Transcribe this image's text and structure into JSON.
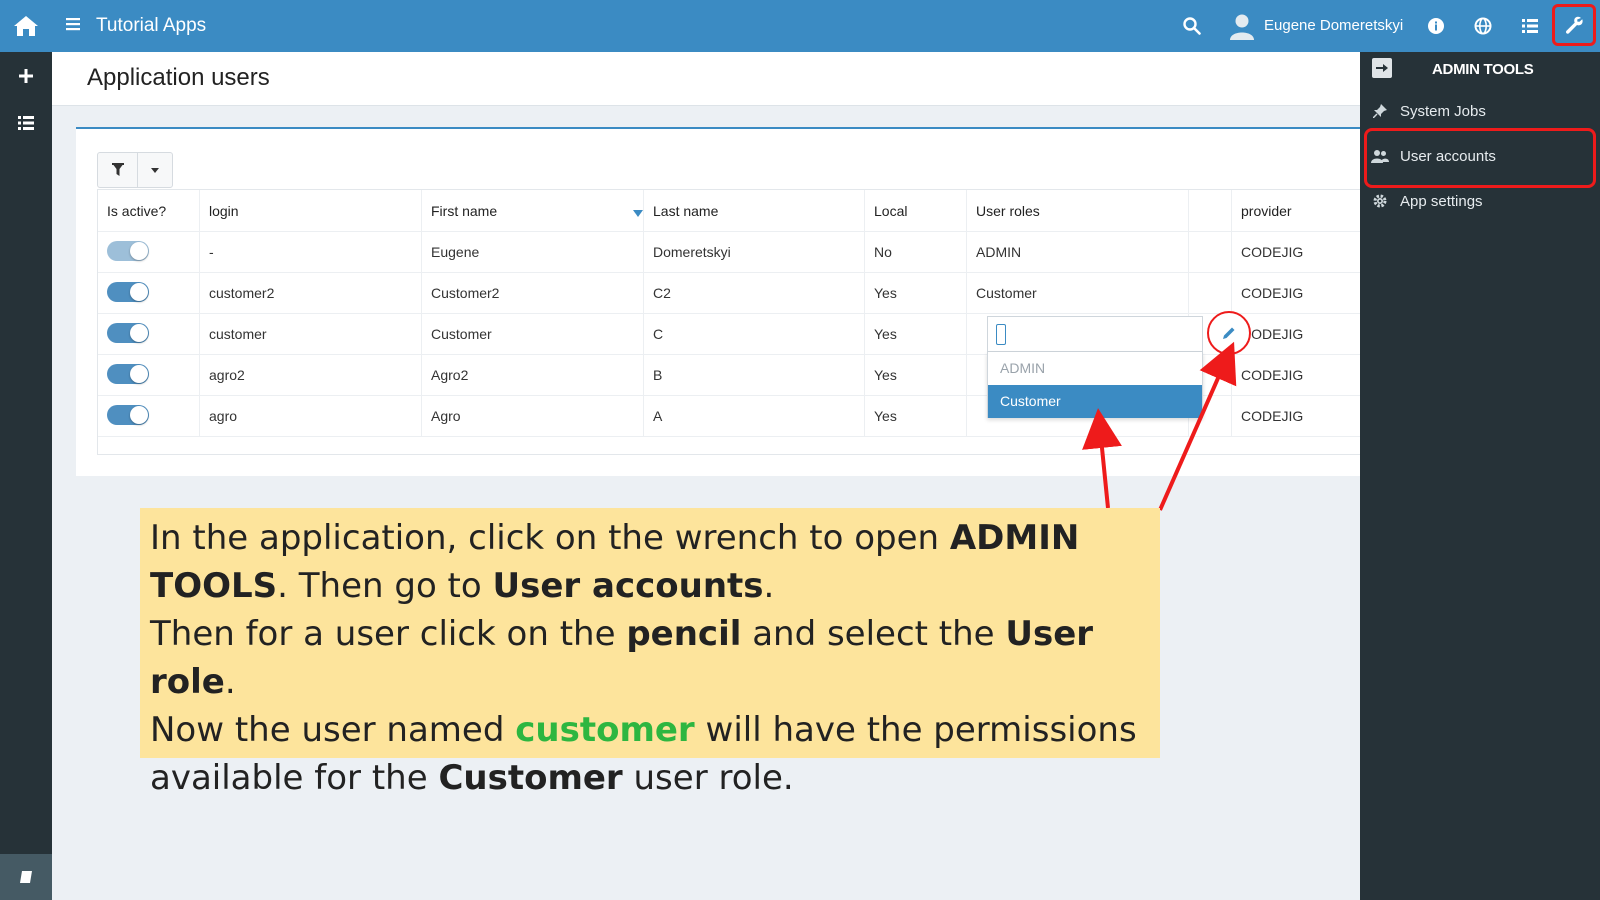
{
  "topbar": {
    "app_title": "Tutorial Apps",
    "user_name": "Eugene Domeretskyi"
  },
  "page": {
    "title": "Application users"
  },
  "grid": {
    "columns": [
      "Is active?",
      "login",
      "First name",
      "Last name",
      "Local",
      "User roles",
      "",
      "provider"
    ],
    "rows": [
      {
        "active": true,
        "dim": true,
        "login": "-",
        "first": "Eugene",
        "last": "Domeretskyi",
        "local": "No",
        "roles": "ADMIN",
        "provider": "CODEJIG"
      },
      {
        "active": true,
        "dim": false,
        "login": "customer2",
        "first": "Customer2",
        "last": "C2",
        "local": "Yes",
        "roles": "Customer",
        "provider": "CODEJIG"
      },
      {
        "active": true,
        "dim": false,
        "login": "customer",
        "first": "Customer",
        "last": "C",
        "local": "Yes",
        "roles": "",
        "provider": "CODEJIG"
      },
      {
        "active": true,
        "dim": false,
        "login": "agro2",
        "first": "Agro2",
        "last": "B",
        "local": "Yes",
        "roles": "",
        "provider": "CODEJIG"
      },
      {
        "active": true,
        "dim": false,
        "login": "agro",
        "first": "Agro",
        "last": "A",
        "local": "Yes",
        "roles": "",
        "provider": "CODEJIG"
      }
    ]
  },
  "role_dropdown": {
    "options": [
      "ADMIN",
      "Customer"
    ],
    "selected": "Customer"
  },
  "admin_panel": {
    "title": "ADMIN TOOLS",
    "items": [
      "System Jobs",
      "User accounts",
      "App settings"
    ]
  },
  "callout": {
    "line1_a": "In the application, click on the wrench to open ",
    "line1_b": "ADMIN TOOLS",
    "line2_a": ". Then go to ",
    "line2_b": "User accounts",
    "line2_c": ".",
    "line3_a": "Then for a user click on the ",
    "line3_b": "pencil",
    "line3_c": " and select the ",
    "line3_d": "User role",
    "line3_e": ".",
    "line4_a": "Now the user named ",
    "line4_b": "customer",
    "line4_c": " will have the permissions",
    "line5_a": "available for the ",
    "line5_b": "Customer",
    "line5_c": " user role."
  },
  "colors": {
    "primary": "#3b8bc3",
    "dark": "#263238",
    "annotation_red": "#ee1b1b",
    "callout_bg": "#fde49c",
    "highlight_green": "#2db640"
  }
}
